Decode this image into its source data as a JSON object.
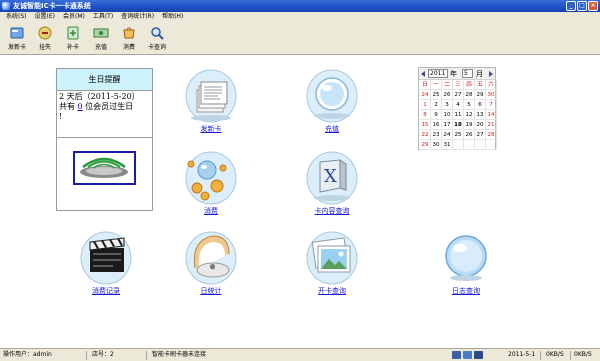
{
  "window": {
    "title": "友诚智能IC卡一卡通系统"
  },
  "menu": [
    {
      "label": "系统(S)"
    },
    {
      "label": "设置(E)"
    },
    {
      "label": "会员(M)"
    },
    {
      "label": "工具(T)"
    },
    {
      "label": "查询统计(R)"
    },
    {
      "label": "帮助(H)"
    }
  ],
  "toolbar": [
    {
      "label": "发新卡",
      "icon": "new-card-icon"
    },
    {
      "label": "挂失",
      "icon": "report-loss-icon"
    },
    {
      "label": "补卡",
      "icon": "replace-card-icon"
    },
    {
      "label": "充值",
      "icon": "recharge-icon"
    },
    {
      "label": "消费",
      "icon": "consume-icon"
    },
    {
      "label": "卡查询",
      "icon": "card-query-icon"
    }
  ],
  "birthday": {
    "header": "生日提醒",
    "line1": "2 天后（2011-5-20）",
    "line2_prefix": "共有 ",
    "count": "0",
    "line2_suffix": " 位会员过生日",
    "line3": "!"
  },
  "functions": [
    {
      "label": "发新卡",
      "icon": "document-stack-icon"
    },
    {
      "label": "充值",
      "icon": "glass-sphere-icon"
    },
    {
      "label": "消费",
      "icon": "orange-bubbles-icon"
    },
    {
      "label": "卡内容查询",
      "icon": "x-window-icon"
    },
    {
      "label": "消费记录",
      "icon": "clapperboard-icon"
    },
    {
      "label": "日统计",
      "icon": "mac-drive-icon"
    },
    {
      "label": "开卡查询",
      "icon": "photo-frame-icon"
    },
    {
      "label": "日志查询",
      "icon": "blue-sphere-icon"
    }
  ],
  "calendar": {
    "year": "2011",
    "year_label": "年",
    "month": "5",
    "month_label": "月",
    "weekdays": [
      "日",
      "一",
      "二",
      "三",
      "四",
      "五",
      "六"
    ],
    "days": [
      "24",
      "25",
      "26",
      "27",
      "28",
      "29",
      "30",
      "1",
      "2",
      "3",
      "4",
      "5",
      "6",
      "7",
      "8",
      "9",
      "10",
      "11",
      "12",
      "13",
      "14",
      "15",
      "16",
      "17",
      "18",
      "19",
      "20",
      "21",
      "22",
      "23",
      "24",
      "25",
      "26",
      "27",
      "28",
      "29",
      "30",
      "31",
      "",
      "",
      "",
      ""
    ],
    "today": "18"
  },
  "status": {
    "operator": "操作用户：admin",
    "shop": "店号：2",
    "reader": "智能卡刷卡器未连接",
    "date": "2011-5-1",
    "speed1": "0KB/S",
    "speed2": "0KB/S"
  },
  "colors": {
    "titlebar": "#1c4fc4",
    "link": "#1a1ad6",
    "birthday_header": "#ccf3fb"
  }
}
